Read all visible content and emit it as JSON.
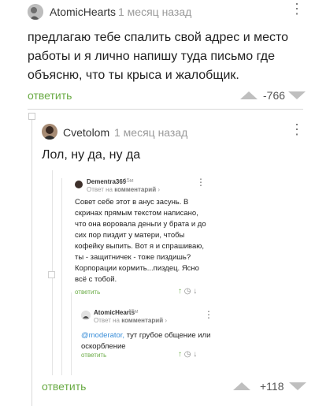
{
  "comment1": {
    "author": "AtomicHearts",
    "time": "1 месяц назад",
    "text": "предлагаю тебе спалить свой адрес и место работы и я лично напишу туда письмо где объясню, что ты крыса и жалобщик.",
    "reply_label": "ответить",
    "rating": "-766"
  },
  "comment2": {
    "author": "Cvetolom",
    "time": "1 месяц назад",
    "text": "Лол, ну да, ну да",
    "reply_label": "ответить",
    "rating": "+118"
  },
  "screenshot": {
    "c1": {
      "author": "Dementra369",
      "time": "15м",
      "reply_to_prefix": "Ответ на",
      "reply_to_target": "комментарий",
      "text1": "Совет себе этот в анус засунь. В скринах прямым текстом написано, что она воровала деньги у брата и до сих пор пиздит у матери, чтобы кофейку выпить. Вот я и спрашиваю, ты - защитничек - тоже пиздишь?",
      "text2": "Корпорации кормить...пиздец. Ясно всё с тобой.",
      "reply_label": "ответить"
    },
    "c2": {
      "author": "AtomicHearts",
      "time": "15м",
      "reply_to_prefix": "Ответ на",
      "reply_to_target": "комментарий",
      "mention": "@moderator,",
      "text": " тут грубое общение или оскорбление",
      "reply_label": "ответить"
    }
  },
  "icons": {
    "more": "vertical-dots-icon",
    "upvote": "triangle-up-icon",
    "downvote": "triangle-down-icon",
    "collapse": "collapse-square-icon",
    "arrow_up": "arrow-up-icon",
    "clock": "clock-icon",
    "arrow_down": "arrow-down-icon"
  },
  "colors": {
    "reply": "#6aab45",
    "vote": "#bfbfbf",
    "mention": "#3a8ed8"
  }
}
